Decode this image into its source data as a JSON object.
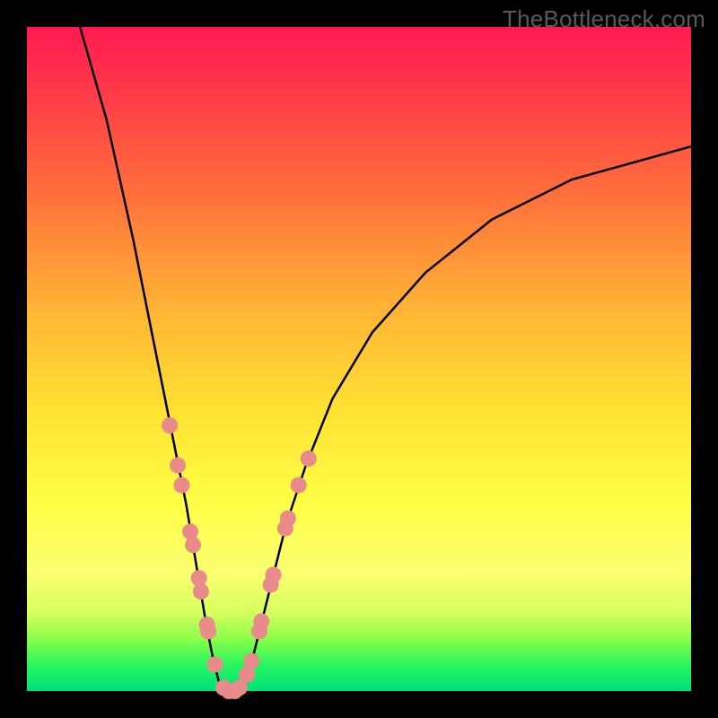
{
  "watermark": "TheBottleneck.com",
  "chart_data": {
    "type": "line",
    "title": "",
    "xlabel": "",
    "ylabel": "",
    "xlim": [
      0,
      100
    ],
    "ylim": [
      0,
      100
    ],
    "grid": false,
    "legend": false,
    "curve_description": "V-shaped bottleneck curve: steep descent on left, minimum near x≈30 at y≈0, gentler rise on right",
    "curve_points": [
      {
        "x": 8,
        "y": 100
      },
      {
        "x": 12,
        "y": 86
      },
      {
        "x": 16,
        "y": 68
      },
      {
        "x": 20,
        "y": 48
      },
      {
        "x": 22,
        "y": 38
      },
      {
        "x": 24,
        "y": 28
      },
      {
        "x": 25,
        "y": 22
      },
      {
        "x": 26,
        "y": 16
      },
      {
        "x": 27,
        "y": 10
      },
      {
        "x": 28,
        "y": 5
      },
      {
        "x": 29,
        "y": 1
      },
      {
        "x": 30,
        "y": 0
      },
      {
        "x": 31,
        "y": 0
      },
      {
        "x": 32,
        "y": 0.5
      },
      {
        "x": 33,
        "y": 2
      },
      {
        "x": 34,
        "y": 5
      },
      {
        "x": 35,
        "y": 9
      },
      {
        "x": 37,
        "y": 17
      },
      {
        "x": 39,
        "y": 25
      },
      {
        "x": 42,
        "y": 34
      },
      {
        "x": 46,
        "y": 44
      },
      {
        "x": 52,
        "y": 54
      },
      {
        "x": 60,
        "y": 63
      },
      {
        "x": 70,
        "y": 71
      },
      {
        "x": 82,
        "y": 77
      },
      {
        "x": 100,
        "y": 82
      }
    ],
    "markers": [
      {
        "x": 21.5,
        "y": 40
      },
      {
        "x": 22.7,
        "y": 34
      },
      {
        "x": 23.3,
        "y": 31
      },
      {
        "x": 24.6,
        "y": 24
      },
      {
        "x": 25.0,
        "y": 22
      },
      {
        "x": 25.9,
        "y": 17
      },
      {
        "x": 26.2,
        "y": 15
      },
      {
        "x": 27.1,
        "y": 10
      },
      {
        "x": 27.3,
        "y": 9
      },
      {
        "x": 28.3,
        "y": 4
      },
      {
        "x": 29.6,
        "y": 0.5
      },
      {
        "x": 30.4,
        "y": 0
      },
      {
        "x": 31.3,
        "y": 0
      },
      {
        "x": 32.0,
        "y": 0.5
      },
      {
        "x": 33.1,
        "y": 2.5
      },
      {
        "x": 33.8,
        "y": 4.5
      },
      {
        "x": 35.0,
        "y": 9
      },
      {
        "x": 35.3,
        "y": 10.5
      },
      {
        "x": 36.7,
        "y": 16
      },
      {
        "x": 37.1,
        "y": 17.5
      },
      {
        "x": 38.9,
        "y": 24.5
      },
      {
        "x": 39.3,
        "y": 26
      },
      {
        "x": 40.9,
        "y": 31
      },
      {
        "x": 42.4,
        "y": 35
      }
    ],
    "marker_color": "#e98b8b",
    "marker_radius": 9
  }
}
